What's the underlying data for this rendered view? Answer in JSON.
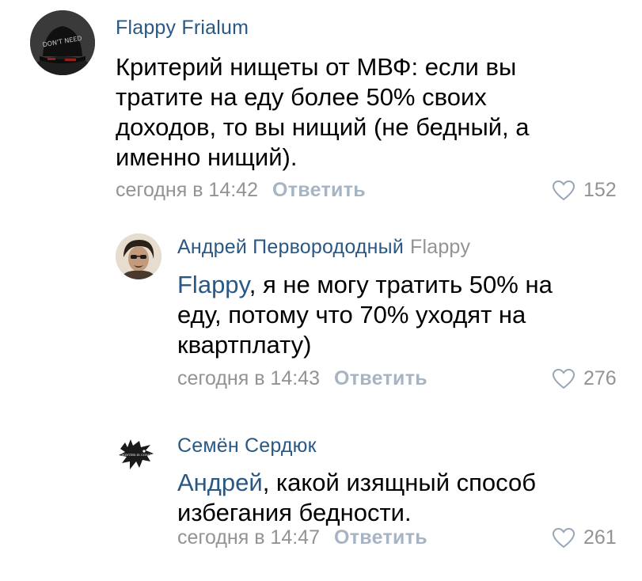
{
  "comments": [
    {
      "author": "Flappy Frialum",
      "text": "Критерий нищеты от МВФ: если вы тратите на еду более 50% своих доходов, то вы нищий (не бедный, а именно нищий).",
      "time": "сегодня в 14:42",
      "reply_label": "Ответить",
      "likes": "152",
      "avatar_icon": "hat-avatar-icon",
      "avatar_caption": "DON'T NEED"
    },
    {
      "author": "Андрей Перворододный",
      "reply_to": "Flappy",
      "mention": "Flappy",
      "text": ", я не могу тратить 50% на еду, потому что 70% уходят на квартплату)",
      "time": "сегодня в 14:43",
      "reply_label": "Ответить",
      "likes": "276",
      "avatar_icon": "portrait-avatar-icon"
    },
    {
      "author": "Семён Сердюк",
      "mention": "Андрей",
      "text": ", какой изящный способ избегания бедности.",
      "time": "сегодня в 14:47",
      "reply_label": "Ответить",
      "likes": "261",
      "avatar_icon": "wolf-sigil-avatar-icon",
      "avatar_caption": "WINTER IS COMING"
    }
  ],
  "colors": {
    "link": "#2a5885",
    "meta": "#939393",
    "reply_link": "#a7b4c3",
    "text": "#000000"
  }
}
